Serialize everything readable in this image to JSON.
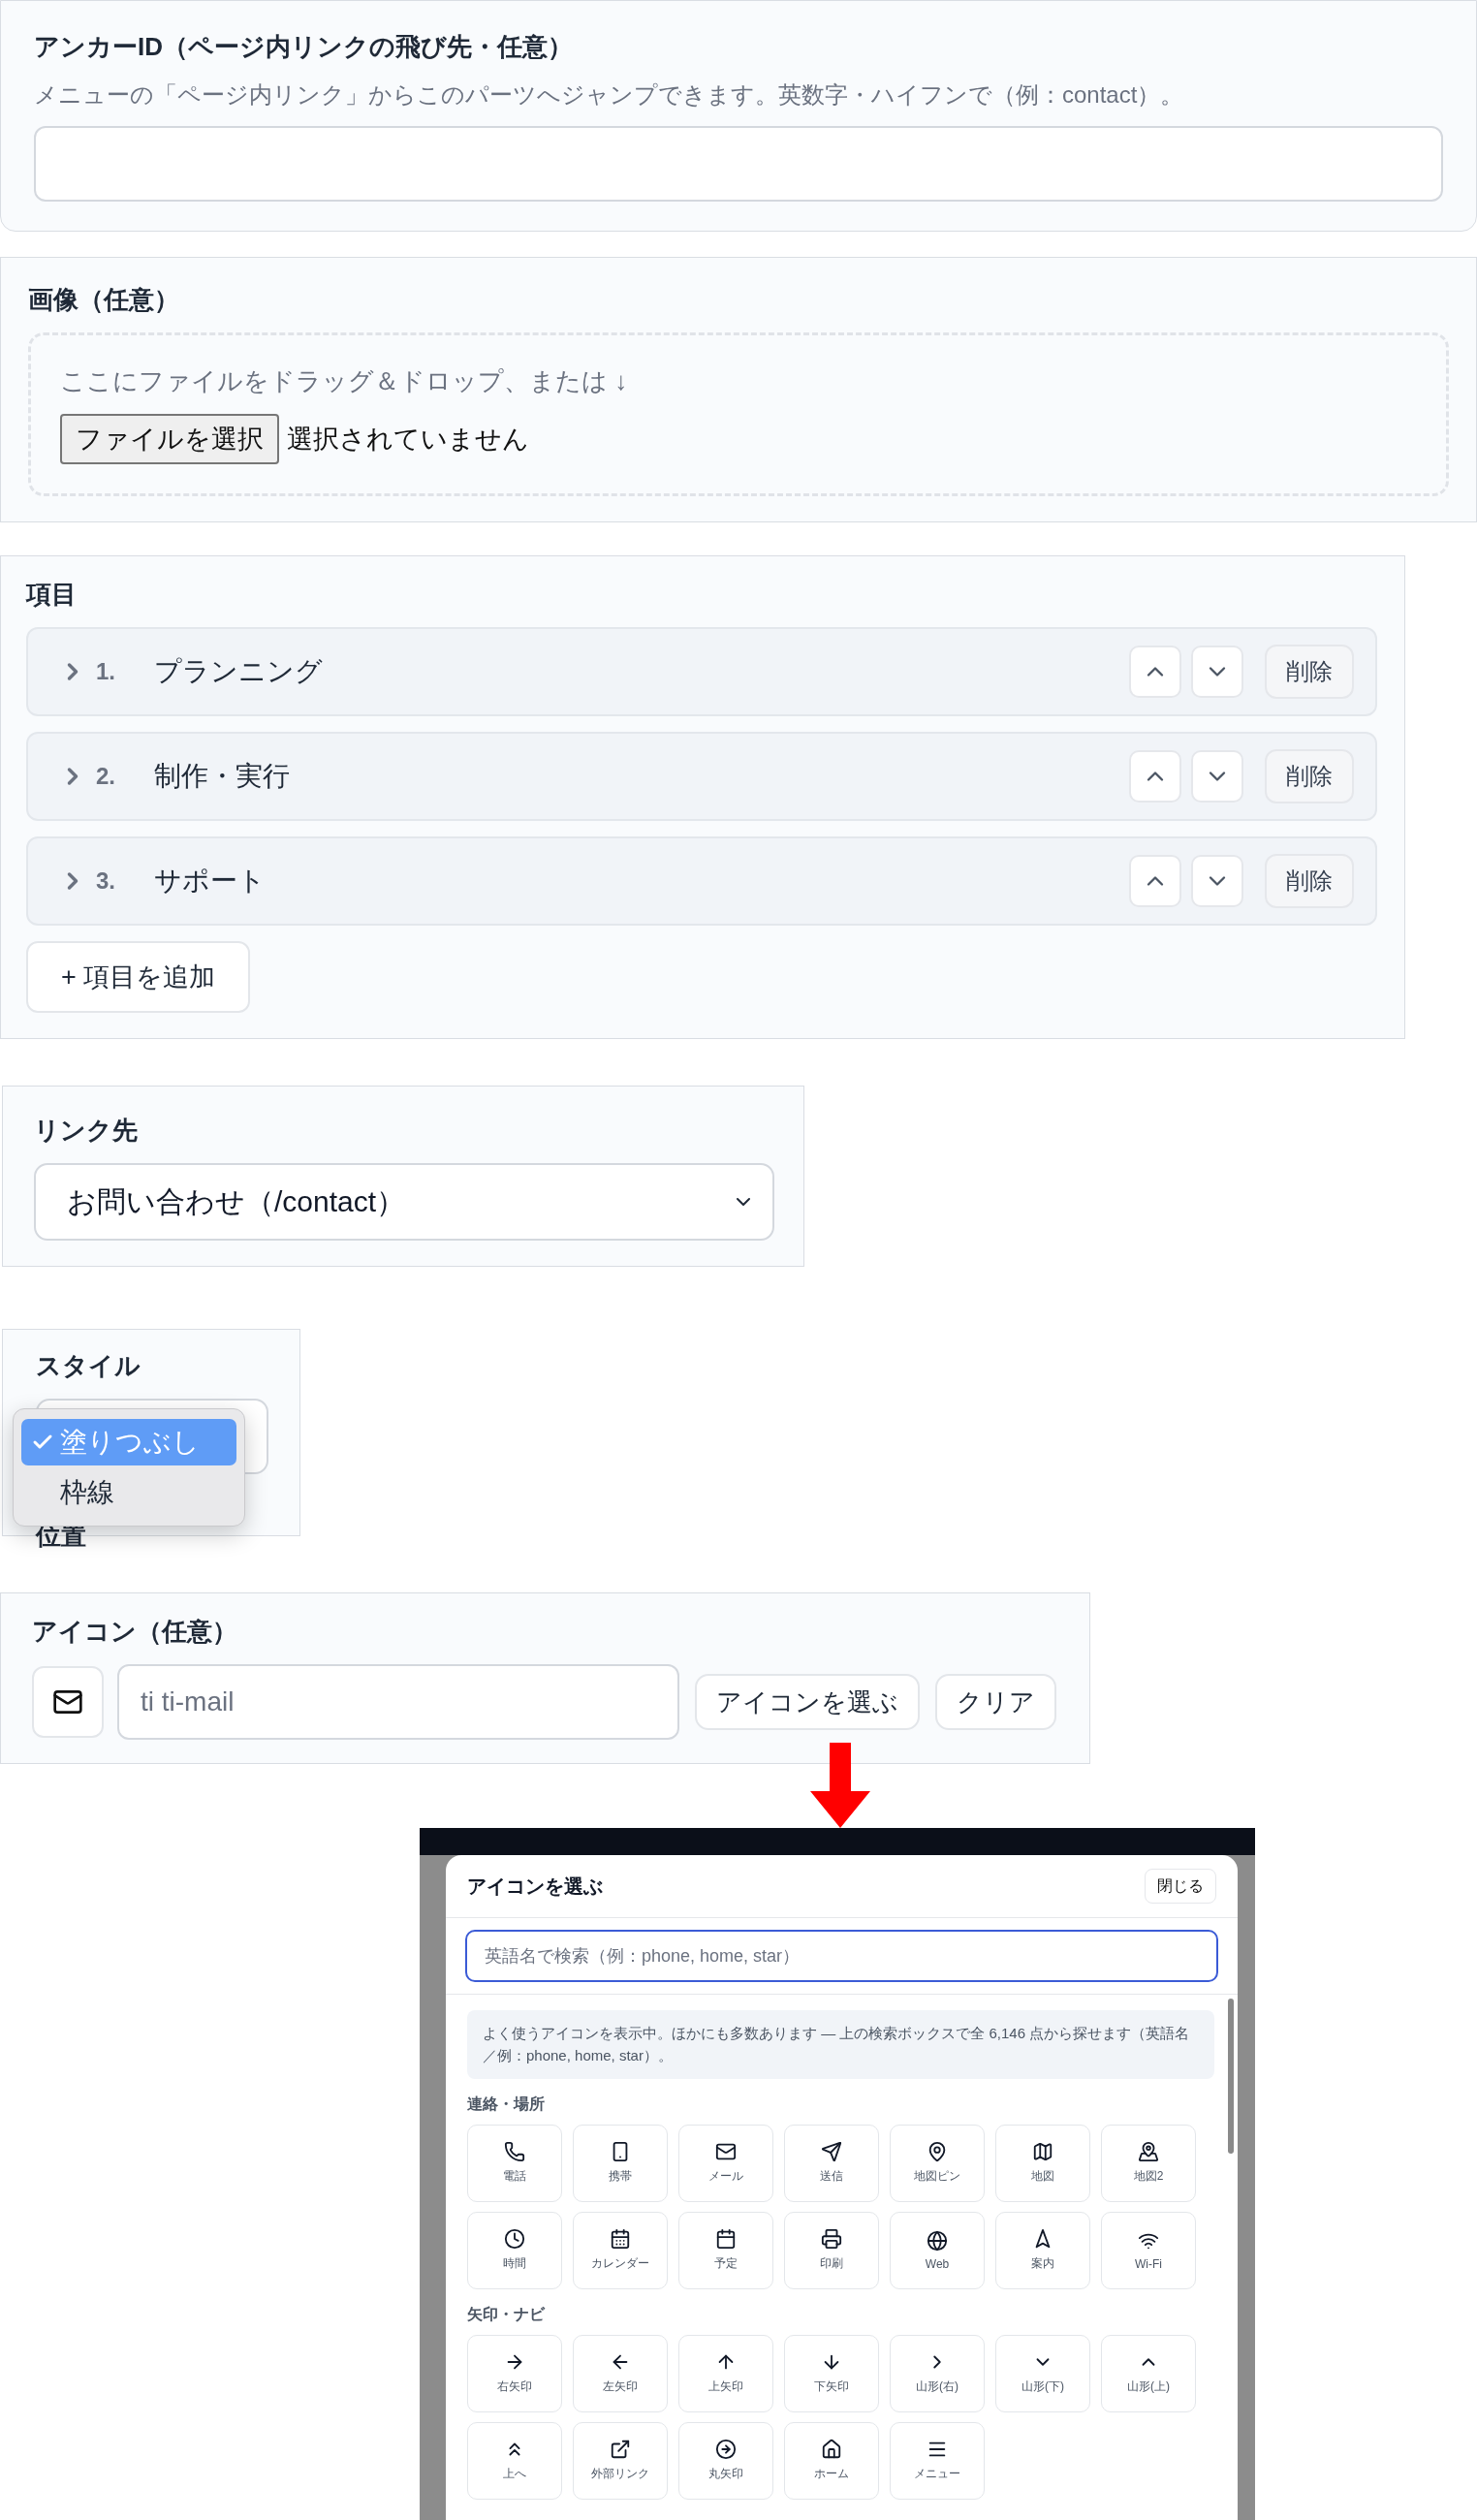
{
  "anchor_section": {
    "title": "アンカーID（ページ内リンクの飛び先・任意）",
    "description": "メニューの「ページ内リンク」からこのパーツへジャンプできます。英数字・ハイフンで（例：contact）。"
  },
  "image_section": {
    "title": "画像（任意）",
    "drop_hint": "ここにファイルをドラッグ＆ドロップ、または ↓",
    "file_button": "ファイルを選択",
    "file_status": "選択されていません"
  },
  "items_section": {
    "title": "項目",
    "items": [
      {
        "number": "1.",
        "label": "プランニング",
        "expanded": false,
        "delete_label": "削除"
      },
      {
        "number": "2.",
        "label": "制作・実行",
        "expanded": false,
        "delete_label": "削除"
      },
      {
        "number": "3.",
        "label": "サポート",
        "expanded": false,
        "delete_label": "削除"
      }
    ],
    "add_button": "+ 項目を追加"
  },
  "link_section": {
    "title": "リンク先",
    "value": "お問い合わせ（/contact）"
  },
  "style_section": {
    "title": "スタイル",
    "options": [
      {
        "label": "塗りつぶし",
        "selected": true
      },
      {
        "label": "枠線",
        "selected": false
      }
    ],
    "next_label": "位置"
  },
  "icon_section": {
    "title": "アイコン（任意）",
    "value": "ti ti-mail",
    "choose_button": "アイコンを選ぶ",
    "clear_button": "クリア"
  },
  "icon_picker": {
    "title": "アイコンを選ぶ",
    "close_button": "閉じる",
    "search_placeholder": "英語名で検索（例：phone, home, star）",
    "notice": "よく使うアイコンを表示中。ほかにも多数あります — 上の検索ボックスで全 6,146 点から探せます（英語名／例：phone, home, star）。",
    "groups": [
      {
        "title": "連絡・場所",
        "icons": [
          "電話",
          "携帯",
          "メール",
          "送信",
          "地図ピン",
          "地図",
          "地図2",
          "時間",
          "カレンダー",
          "予定",
          "印刷",
          "Web",
          "案内",
          "Wi-Fi"
        ]
      },
      {
        "title": "矢印・ナビ",
        "icons": [
          "右矢印",
          "左矢印",
          "上矢印",
          "下矢印",
          "山形(右)",
          "山形(下)",
          "山形(上)",
          "上へ",
          "外部リンク",
          "丸矢印",
          "ホーム",
          "メニュー"
        ]
      }
    ]
  }
}
